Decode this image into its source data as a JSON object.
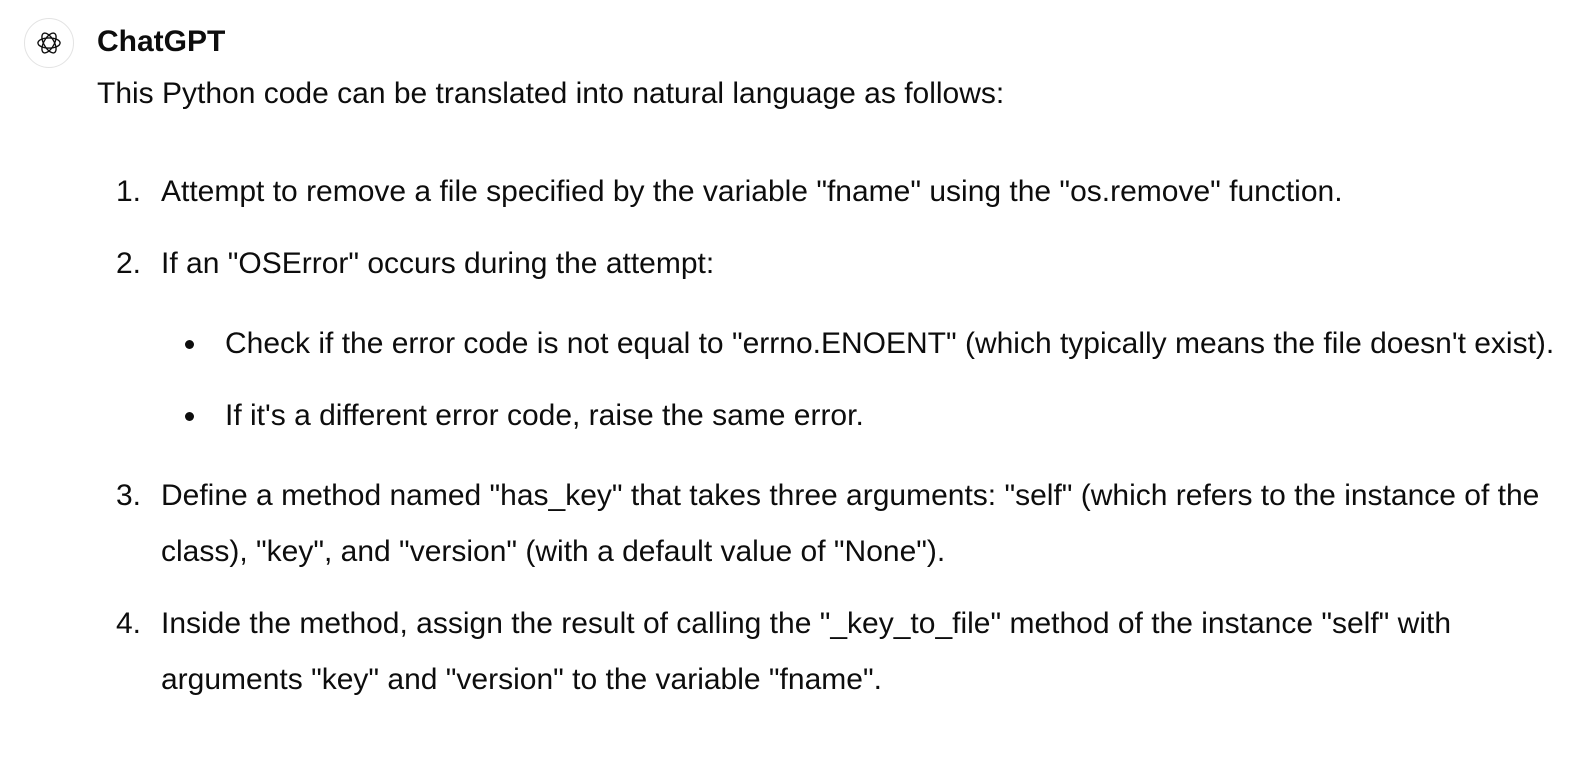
{
  "message": {
    "author": "ChatGPT",
    "avatar_icon": "openai-logo-icon",
    "intro": "This Python code can be translated into natural language as follows:",
    "steps": [
      {
        "number": "1.",
        "text": "Attempt to remove a file specified by the variable \"fname\" using the \"os.remove\" function."
      },
      {
        "number": "2.",
        "text": "If an \"OSError\" occurs during the attempt:",
        "sub_items": [
          "Check if the error code is not equal to \"errno.ENOENT\" (which typically means the file doesn't exist).",
          "If it's a different error code, raise the same error."
        ]
      },
      {
        "number": "3.",
        "text": "Define a method named \"has_key\" that takes three arguments: \"self\" (which refers to the instance of the class), \"key\", and \"version\" (with a default value of \"None\")."
      },
      {
        "number": "4.",
        "text": "Inside the method, assign the result of calling the \"_key_to_file\" method of the instance \"self\" with arguments \"key\" and \"version\" to the variable \"fname\"."
      }
    ]
  }
}
